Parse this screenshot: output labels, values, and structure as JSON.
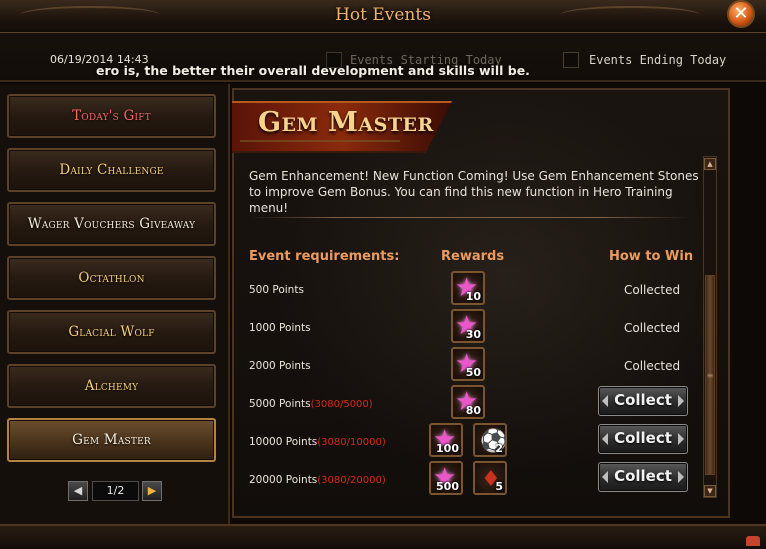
{
  "window": {
    "title": "Hot Events",
    "close_glyph": "✕"
  },
  "header": {
    "timestamp": "06/19/2014 14:43",
    "marquee": "ero is, the better their overall development and skills will be.",
    "filters": {
      "starting_today_label": "Events Starting Today",
      "ending_today_label": "Events Ending Today"
    }
  },
  "sidebar": {
    "items": [
      {
        "label": "Today's Gift"
      },
      {
        "label": "Daily Challenge"
      },
      {
        "label": "Wager Vouchers Giveaway"
      },
      {
        "label": "Octathlon"
      },
      {
        "label": "Glacial Wolf"
      },
      {
        "label": "Alchemy"
      },
      {
        "label": "Gem Master"
      }
    ],
    "active_index": 6,
    "pager": {
      "display": "1/2",
      "prev_glyph": "◀",
      "next_glyph": "▶"
    }
  },
  "event": {
    "title": "Gem Master",
    "description": "Gem Enhancement! New Function Coming! Use Gem Enhancement Stones to improve Gem Bonus. You can find this new function in Hero Training menu!",
    "columns": {
      "requirements": "Event requirements:",
      "rewards": "Rewards",
      "how_to_win": "How to Win"
    },
    "rows": [
      {
        "requirement": "500 Points",
        "progress": "",
        "rewards": [
          {
            "icon": "gem-stone-icon",
            "qty": "10"
          }
        ],
        "status": "Collected"
      },
      {
        "requirement": "1000 Points",
        "progress": "",
        "rewards": [
          {
            "icon": "gem-stone-icon",
            "qty": "30"
          }
        ],
        "status": "Collected"
      },
      {
        "requirement": "2000 Points",
        "progress": "",
        "rewards": [
          {
            "icon": "gem-stone-icon",
            "qty": "50"
          }
        ],
        "status": "Collected"
      },
      {
        "requirement": "5000 Points",
        "progress": "(3080/5000)",
        "rewards": [
          {
            "icon": "gem-stone-icon",
            "qty": "80"
          }
        ],
        "button": "Collect"
      },
      {
        "requirement": "10000 Points",
        "progress": "(3080/10000)",
        "rewards": [
          {
            "icon": "gem-stone-icon",
            "qty": "100"
          },
          {
            "icon": "ball-icon",
            "qty": "2"
          }
        ],
        "button": "Collect"
      },
      {
        "requirement": "20000 Points",
        "progress": "(3080/20000)",
        "rewards": [
          {
            "icon": "gem-stone-icon",
            "qty": "500"
          },
          {
            "icon": "card-pack-icon",
            "qty": "5"
          }
        ],
        "button": "Collect"
      }
    ]
  },
  "colors": {
    "accent_orange": "#ec9b5e",
    "progress_red": "#d72a16",
    "gold_text": "#f3cf7a"
  }
}
